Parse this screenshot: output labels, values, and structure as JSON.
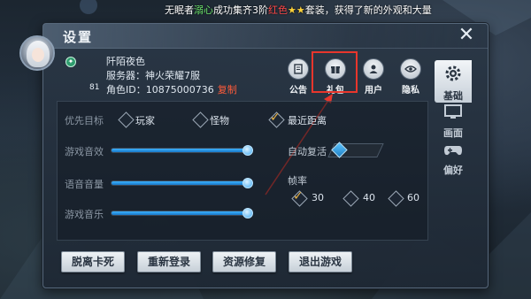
{
  "ticker": {
    "prefix": "无眠者",
    "name": "溺心",
    "mid": "成功集齐3阶",
    "red_word": "红色",
    "stars": "★★",
    "suffix": "套装，获得了新的外观和大量"
  },
  "panel": {
    "title": "设置",
    "close_icon": "close-icon"
  },
  "profile": {
    "name": "阡陌夜色",
    "server": "服务器：神火荣耀7服",
    "role_id": "角色ID：10875000736",
    "copy_label": "复制",
    "level": "81"
  },
  "top_icons": [
    {
      "label": "公告",
      "icon": "notice-icon"
    },
    {
      "label": "礼包",
      "icon": "gift-icon"
    },
    {
      "label": "用户",
      "icon": "user-icon"
    },
    {
      "label": "隐私",
      "icon": "eye-icon"
    }
  ],
  "side_tabs": [
    {
      "label": "基础",
      "icon": "gear-icon",
      "active": true
    },
    {
      "label": "画面",
      "icon": "monitor-icon",
      "active": false
    },
    {
      "label": "偏好",
      "icon": "gamepad-icon",
      "active": false
    }
  ],
  "settings": {
    "priority_label": "优先目标",
    "priority_options": [
      "玩家",
      "怪物",
      "最近距离"
    ],
    "priority_selected": "最近距离",
    "game_sfx_label": "游戏音效",
    "voice_volume_label": "语音音量",
    "music_label": "游戏音乐",
    "game_sfx_value": 1.0,
    "voice_volume_value": 1.0,
    "music_value": 1.0,
    "auto_revive_label": "自动复活",
    "auto_revive_on": false,
    "fps_label": "帧率",
    "fps_options": [
      "30",
      "40",
      "60"
    ],
    "fps_selected": "30"
  },
  "buttons": {
    "unstuck": "脱离卡死",
    "relogin": "重新登录",
    "repair": "资源修复",
    "quit": "退出游戏"
  },
  "colors": {
    "accent_blue": "#2e9bf0",
    "highlight_red": "#e8362c",
    "copy_red": "#ff5b3a"
  }
}
